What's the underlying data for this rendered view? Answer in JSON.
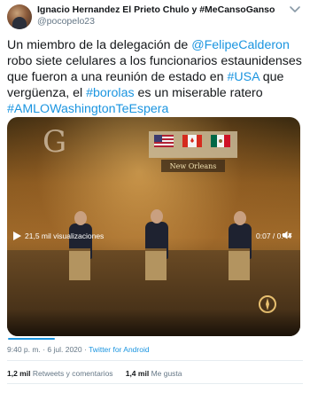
{
  "author": {
    "display_name": "Ignacio Hernandez El Prieto Chulo y #MeCansoGanso",
    "handle": "@pocopelo23"
  },
  "tweet": {
    "segments": [
      {
        "text": "Un miembro de la delegación de ",
        "link": false
      },
      {
        "text": "@FelipeCalderon",
        "link": true
      },
      {
        "text": " robo siete celulares a los funcionarios estaunidenses que fueron a una reunión de estado en ",
        "link": false
      },
      {
        "text": "#USA",
        "link": true
      },
      {
        "text": " que vergüenza, el ",
        "link": false
      },
      {
        "text": "#borolas",
        "link": true
      },
      {
        "text": " es un miserable ratero ",
        "link": false
      },
      {
        "text": "#AMLOWashingtonTeEspera",
        "link": true
      }
    ]
  },
  "video": {
    "views_label": "21,5 mil visualizaciones",
    "time_label": "0:07 / 0:44",
    "progress": 0.16,
    "banner_text": "New Orleans",
    "accent_color": "#1b95e0"
  },
  "meta": {
    "time": "9:40 p. m.",
    "separator": "·",
    "date": "6 jul. 2020",
    "source": "Twitter for Android"
  },
  "stats": {
    "retweets_count": "1,2 mil",
    "retweets_label": "Retweets y comentarios",
    "likes_count": "1,4 mil",
    "likes_label": "Me gusta"
  }
}
